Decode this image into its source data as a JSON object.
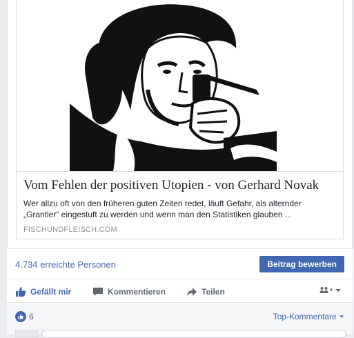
{
  "link_preview": {
    "headline": "Vom Fehlen der positiven Utopien - von Gerhard Novak",
    "description": "Wer allzu oft von den früheren guten Zeiten redet, läuft Gefahr, als alternder „Grantler“ eingestuft zu werden und wenn man den Statistiken glauben ...",
    "domain": "FISCHUNDFLEISCH.COM"
  },
  "reach": {
    "text": "4.734 erreichte Personen",
    "boost_label": "Beitrag bewerben"
  },
  "actions": {
    "like_label": "Gefällt mir",
    "comment_label": "Kommentieren",
    "share_label": "Teilen",
    "audience_icon": "friends-plus-icon"
  },
  "reactions": {
    "like_count": "6",
    "sort_label": "Top-Kommentare"
  },
  "colors": {
    "accent": "#4267b2",
    "text": "#1d2129",
    "muted": "#606770"
  }
}
